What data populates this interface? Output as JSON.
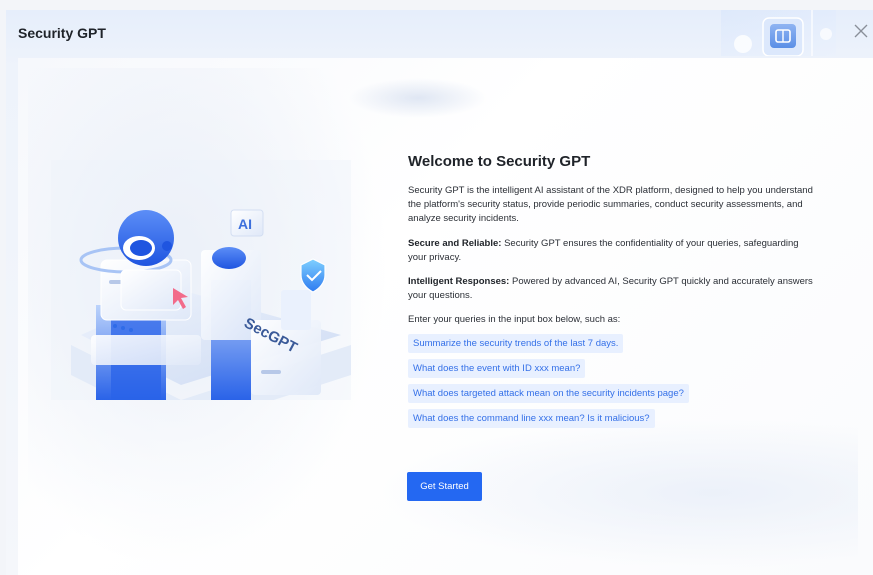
{
  "dialog": {
    "title": "Security GPT",
    "close_icon": "close-icon",
    "header_badge_icon": "gpt-logo-icon"
  },
  "welcome": {
    "title": "Welcome to Security GPT",
    "intro": "Security GPT is the intelligent AI assistant of the XDR platform, designed to help you understand the platform's security status, provide periodic summaries, conduct security assessments, and analyze security incidents.",
    "secure_label": "Secure and Reliable:",
    "secure_text": " Security GPT ensures the confidentiality of your queries, safeguarding your privacy.",
    "intelligent_label": "Intelligent Responses:",
    "intelligent_text": " Powered by advanced AI, Security GPT quickly and accurately answers your questions.",
    "examples_intro": "Enter your queries in the input box below, such as:",
    "examples": [
      "Summarize the security trends of the last 7 days.",
      "What does the event with ID xxx mean?",
      "What does targeted attack mean on the security incidents page?",
      "What does the command line xxx mean? Is it malicious?"
    ],
    "start_button": "Get Started"
  },
  "illustration": {
    "ai_label": "AI",
    "secgpt_label": "SecGPT",
    "icons": [
      "robot-head-icon",
      "shield-icon",
      "cursor-icon"
    ]
  },
  "colors": {
    "accent": "#2468f2",
    "example_bg": "#e8f0ff",
    "example_text": "#3470e8",
    "title_text": "#1f2329"
  }
}
